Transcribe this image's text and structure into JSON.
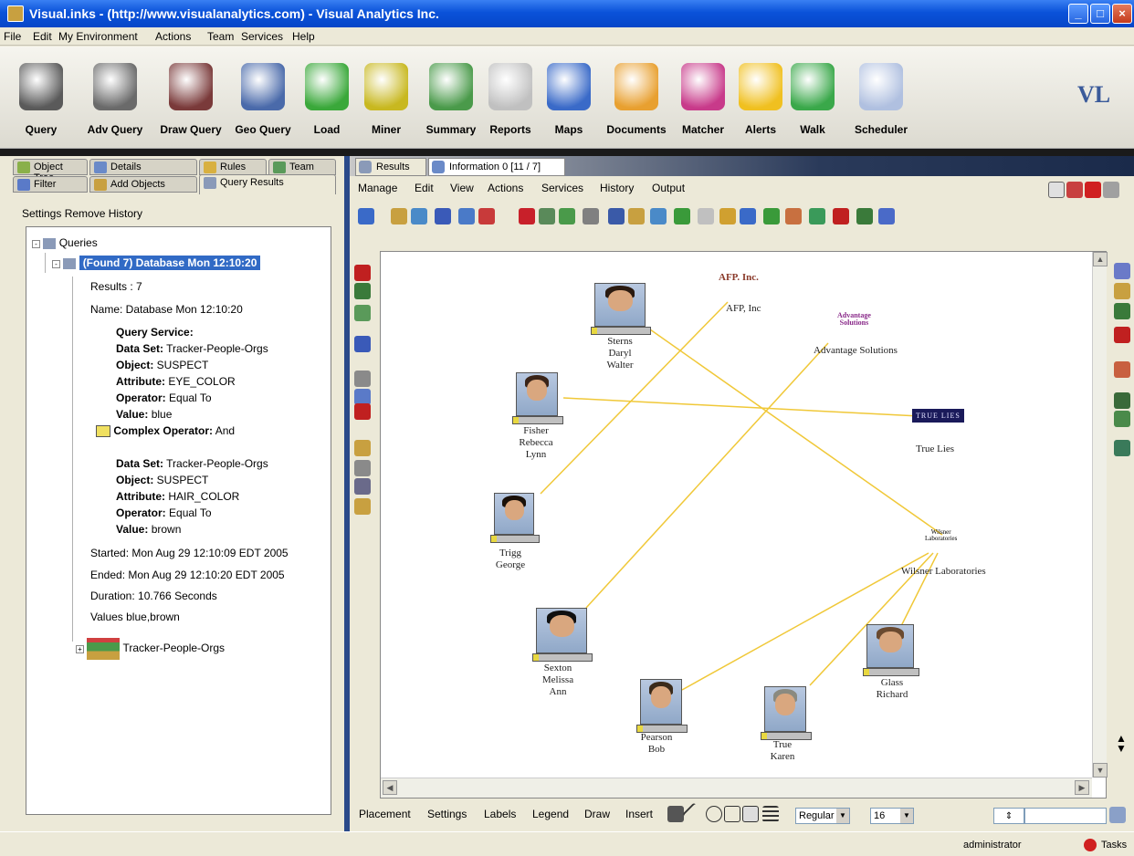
{
  "window": {
    "title": "Visual.inks - (http://www.visualanalytics.com) - Visual Analytics Inc.",
    "min_icon": "minimize-icon",
    "max_icon": "maximize-icon",
    "close_icon": "close-icon"
  },
  "menu": [
    "File",
    "Edit",
    "My Environment",
    "Actions",
    "Team",
    "Services",
    "Help"
  ],
  "toolbar": [
    {
      "label": "Query",
      "icon": "binoculars-icon",
      "color": "#5a5a5a"
    },
    {
      "label": "Adv Query",
      "icon": "adv-query-icon",
      "color": "#6a6a6a"
    },
    {
      "label": "Draw Query",
      "icon": "draw-query-icon",
      "color": "#7a3a3a"
    },
    {
      "label": "Geo Query",
      "icon": "geo-query-icon",
      "color": "#4a6aaa"
    },
    {
      "label": "Load",
      "icon": "load-icon",
      "color": "#3aa83a"
    },
    {
      "label": "Miner",
      "icon": "miner-icon",
      "color": "#c8b820"
    },
    {
      "label": "Summary",
      "icon": "summary-icon",
      "color": "#4a9a4a"
    },
    {
      "label": "Reports",
      "icon": "reports-icon",
      "color": "#c0c0c0"
    },
    {
      "label": "Maps",
      "icon": "maps-icon",
      "color": "#3a6ac8"
    },
    {
      "label": "Documents",
      "icon": "documents-icon",
      "color": "#e8a030"
    },
    {
      "label": "Matcher",
      "icon": "matcher-icon",
      "color": "#c83a8a"
    },
    {
      "label": "Alerts",
      "icon": "bell-icon",
      "color": "#f0c020"
    },
    {
      "label": "Walk",
      "icon": "walk-icon",
      "color": "#3aa84a"
    },
    {
      "label": "Scheduler",
      "icon": "scheduler-icon",
      "color": "#b0c0e0"
    }
  ],
  "brand": {
    "text": "VL",
    "icon": "logo-icon"
  },
  "left_tabs": {
    "row1": [
      "Object Tree",
      "Details",
      "Rules",
      "Team"
    ],
    "row2": [
      "Filter",
      "Add Objects",
      "Query Results"
    ]
  },
  "left_menu": "Settings  Remove  History",
  "tree": {
    "root": "Queries",
    "selected": "(Found 7) Database Mon 12:10:20",
    "results": "Results : 7",
    "name": "Name: Database Mon 12:10:20",
    "query_service": "Query Service:",
    "ds1_label": "Data Set:",
    "ds1_value": " Tracker-People-Orgs",
    "obj1_label": "Object:",
    "obj1_value": " SUSPECT",
    "attr1_label": "Attribute:",
    "attr1_value": " EYE_COLOR",
    "op1_label": "Operator:",
    "op1_value": " Equal To",
    "val1_label": "Value:",
    "val1_value": " blue",
    "complex_label": "Complex Operator:",
    "complex_value": " And",
    "ds2_label": "Data Set:",
    "ds2_value": " Tracker-People-Orgs",
    "obj2_label": "Object:",
    "obj2_value": " SUSPECT",
    "attr2_label": "Attribute:",
    "attr2_value": " HAIR_COLOR",
    "op2_label": "Operator:",
    "op2_value": " Equal To",
    "val2_label": "Value:",
    "val2_value": " brown",
    "started": "Started: Mon Aug 29 12:10:09 EDT 2005",
    "ended": "Ended: Mon Aug 29 12:10:20 EDT 2005",
    "duration": "Duration: 10.766 Seconds",
    "values": "Values blue,brown",
    "dataset": "Tracker-People-Orgs"
  },
  "right_tabs": [
    "Results",
    "Information 0 [11 / 7]"
  ],
  "right_menu": [
    "Manage",
    "Edit",
    "View",
    "Actions",
    "Services",
    "History",
    "Output"
  ],
  "graph": {
    "people": [
      {
        "name": "Sterns\nDaryl\nWalter",
        "hair": "#2a1a10"
      },
      {
        "name": "Fisher\nRebecca\nLynn",
        "hair": "#3a2418"
      },
      {
        "name": "Trigg\nGeorge",
        "hair": "#1a1008"
      },
      {
        "name": "Sexton\nMelissa\nAnn",
        "hair": "#101010"
      },
      {
        "name": "Pearson\nBob",
        "hair": "#3a2a1a"
      },
      {
        "name": "True\nKaren",
        "hair": "#8a8a80"
      },
      {
        "name": "Glass\nRichard",
        "hair": "#6a4a30"
      }
    ],
    "orgs": [
      {
        "logo": "AFP. Inc.",
        "name": "AFP, Inc"
      },
      {
        "logo": "Advantage\nSolutions",
        "name": "Advantage Solutions"
      },
      {
        "logo": "TRUE LIES",
        "name": "True Lies"
      },
      {
        "logo": "Wilsner\nLaboratories",
        "name": "Wilsner Laboratories"
      }
    ],
    "link_color": "#f0c838"
  },
  "bottom": {
    "menu": [
      "Placement",
      "Settings",
      "Labels",
      "Legend",
      "Draw",
      "Insert"
    ],
    "font_style": "Regular",
    "font_size": "16"
  },
  "status": {
    "user": "administrator",
    "tasks": "Tasks"
  }
}
